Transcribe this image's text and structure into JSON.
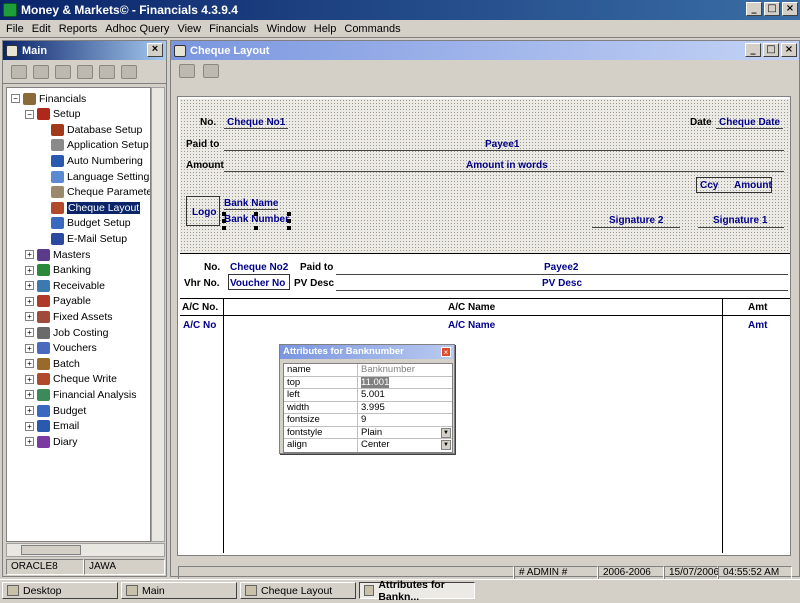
{
  "window": {
    "title": "Money & Markets© - Financials 4.3.9.4",
    "minimize": "_",
    "maximize": "□",
    "close": "×"
  },
  "menu": [
    "File",
    "Edit",
    "Reports",
    "Adhoc Query",
    "View",
    "Financials",
    "Window",
    "Help",
    "Commands"
  ],
  "main_panel": {
    "title": "Main",
    "close": "×",
    "tree": [
      {
        "label": "Financials",
        "level": 0,
        "expander": "−",
        "icon": "#8b6a3a"
      },
      {
        "label": "Setup",
        "level": 1,
        "expander": "−",
        "icon": "#b0281a"
      },
      {
        "label": "Database Setup",
        "level": 2,
        "expander": "",
        "icon": "#a03a1a"
      },
      {
        "label": "Application Setup",
        "level": 2,
        "expander": "",
        "icon": "#8a8a8a"
      },
      {
        "label": "Auto Numbering",
        "level": 2,
        "expander": "",
        "icon": "#2a5ab0"
      },
      {
        "label": "Language Settings",
        "level": 2,
        "expander": "",
        "icon": "#5a8ad0"
      },
      {
        "label": "Cheque Parameters",
        "level": 2,
        "expander": "",
        "icon": "#9a8a6a"
      },
      {
        "label": "Cheque Layout",
        "level": 2,
        "expander": "",
        "icon": "#b04a2a",
        "selected": true
      },
      {
        "label": "Budget Setup",
        "level": 2,
        "expander": "",
        "icon": "#3a6ac0"
      },
      {
        "label": "E-Mail Setup",
        "level": 2,
        "expander": "",
        "icon": "#2a4aa0"
      },
      {
        "label": "Masters",
        "level": 1,
        "expander": "+",
        "icon": "#5a3a8a"
      },
      {
        "label": "Banking",
        "level": 1,
        "expander": "+",
        "icon": "#2a8a3a"
      },
      {
        "label": "Receivable",
        "level": 1,
        "expander": "+",
        "icon": "#3a7ab0"
      },
      {
        "label": "Payable",
        "level": 1,
        "expander": "+",
        "icon": "#b03a2a"
      },
      {
        "label": "Fixed Assets",
        "level": 1,
        "expander": "+",
        "icon": "#a04a3a"
      },
      {
        "label": "Job Costing",
        "level": 1,
        "expander": "+",
        "icon": "#6a6a6a"
      },
      {
        "label": "Vouchers",
        "level": 1,
        "expander": "+",
        "icon": "#4a6ac0"
      },
      {
        "label": "Batch",
        "level": 1,
        "expander": "+",
        "icon": "#9a6a2a"
      },
      {
        "label": "Cheque Write",
        "level": 1,
        "expander": "+",
        "icon": "#b04a2a"
      },
      {
        "label": "Financial Analysis",
        "level": 1,
        "expander": "+",
        "icon": "#3a8a5a"
      },
      {
        "label": "Budget",
        "level": 1,
        "expander": "+",
        "icon": "#3a6ac0"
      },
      {
        "label": "Email",
        "level": 1,
        "expander": "+",
        "icon": "#2a5ab0"
      },
      {
        "label": "Diary",
        "level": 1,
        "expander": "+",
        "icon": "#7a3aa0"
      }
    ],
    "status": [
      "ORACLE8",
      "JAWA"
    ]
  },
  "cheque_window": {
    "title": "Cheque Layout",
    "cheque": {
      "no_label": "No.",
      "no_value": "Cheque No1",
      "date_label": "Date",
      "date_value": "Cheque Date",
      "paidto_label": "Paid to",
      "payee": "Payee1",
      "amount_label": "Amount",
      "amount_words": "Amount in words",
      "ccy": "Ccy",
      "amount": "Amount",
      "logo": "Logo",
      "bank_name": "Bank Name",
      "bank_number": "Bank Number",
      "signature2": "Signature 2",
      "signature1": "Signature 1"
    },
    "voucher": {
      "no_label": "No.",
      "no_value": "Cheque No2",
      "paidto_label": "Paid to",
      "payee": "Payee2",
      "vhr_label": "Vhr No.",
      "vhr_value": "Voucher No",
      "pvdesc_label": "PV Desc",
      "pvdesc_value": "PV Desc",
      "col_acno": "A/C No.",
      "col_acname": "A/C Name",
      "col_amt": "Amt",
      "row_acno": "A/C No",
      "row_acname": "A/C Name",
      "row_amt": "Amt"
    }
  },
  "attributes": {
    "title": "Attributes for Banknumber",
    "close": "×",
    "rows": [
      {
        "key": "name",
        "value": "Banknumber"
      },
      {
        "key": "top",
        "value": "11.001"
      },
      {
        "key": "left",
        "value": "5.001"
      },
      {
        "key": "width",
        "value": "3.995"
      },
      {
        "key": "fontsize",
        "value": "9"
      },
      {
        "key": "fontstyle",
        "value": "Plain"
      },
      {
        "key": "align",
        "value": "Center"
      }
    ]
  },
  "status": [
    "# ADMIN #",
    "2006-2006",
    "15/07/2006",
    "04:55:52 AM"
  ],
  "taskbar": [
    "Desktop",
    "Main",
    "Cheque Layout",
    "Attributes for Bankn..."
  ]
}
